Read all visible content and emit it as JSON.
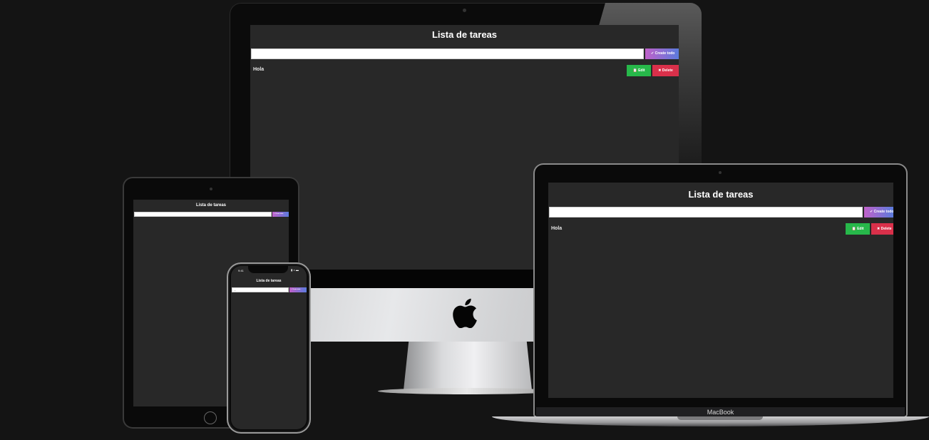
{
  "app": {
    "title": "Lista de tareas",
    "create_label": "✔ Create todo",
    "edit_label": "📋 Edit",
    "delete_label": "✖ Delete",
    "input_value": "",
    "tasks": [
      "Hola"
    ],
    "phone_input_value": "—"
  },
  "devices": {
    "laptop_brand": "MacBook",
    "phone_time": "9:41"
  },
  "colors": {
    "background": "#141414",
    "screen": "#282828",
    "create_gradient_start": "#c061c9",
    "create_gradient_end": "#5b7bdd",
    "edit_green": "#27b84a",
    "delete_red": "#d9304a"
  },
  "icons": [
    "check-icon",
    "clipboard-icon",
    "x-icon",
    "apple-logo-icon",
    "camera-icon",
    "home-button-icon"
  ]
}
